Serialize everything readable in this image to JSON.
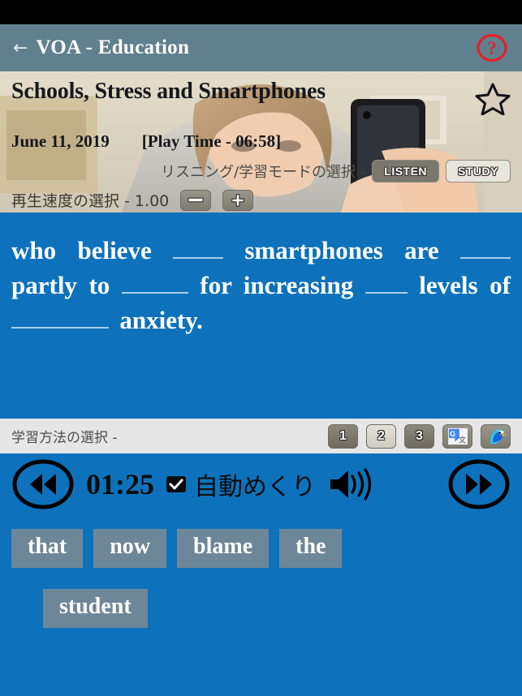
{
  "statusbar": {
    "name": "android-status-bar"
  },
  "appbar": {
    "back_label": "←",
    "title": "VOA - Education",
    "help_label": "?"
  },
  "article": {
    "title": "Schools, Stress and Smartphones",
    "date": "June 11, 2019",
    "play_time": "[Play Time - 06:58]",
    "favorite": "☆"
  },
  "mode_select": {
    "label": "リスニング/学習モードの選択 -",
    "listen_label": "LISTEN",
    "study_label": "STUDY",
    "listen_selected": true,
    "study_selected": false
  },
  "speed_select": {
    "label": "再生速度の選択 - 1.00",
    "value": "1.00",
    "minus_label": "−",
    "plus_label": "+"
  },
  "sentence": {
    "tokens": [
      {
        "type": "word",
        "text": "who"
      },
      {
        "type": "word",
        "text": "believe"
      },
      {
        "type": "blank",
        "size": "w1"
      },
      {
        "type": "word",
        "text": "smartphones"
      },
      {
        "type": "word",
        "text": "are"
      },
      {
        "type": "blank",
        "size": "w1"
      },
      {
        "type": "word",
        "text": "partly"
      },
      {
        "type": "word",
        "text": "to"
      },
      {
        "type": "blank",
        "size": "w2"
      },
      {
        "type": "word",
        "text": "for"
      },
      {
        "type": "word",
        "text": "increasing"
      },
      {
        "type": "blank",
        "size": "w3"
      },
      {
        "type": "word",
        "text": "levels"
      },
      {
        "type": "word",
        "text": "of"
      },
      {
        "type": "blank",
        "size": "w4"
      },
      {
        "type": "word",
        "text": "anxiety."
      }
    ],
    "plain_text": "who believe ____ smartphones are ____ partly to ______ for increasing ___ levels of _______ anxiety."
  },
  "method_select": {
    "label": "学習方法の選択 -",
    "buttons": [
      {
        "label": "1",
        "selected": false,
        "name": "method-button-1"
      },
      {
        "label": "2",
        "selected": true,
        "name": "method-button-2"
      },
      {
        "label": "3",
        "selected": false,
        "name": "method-button-3"
      }
    ],
    "google_translate_label": "G",
    "papago_label": "P"
  },
  "player": {
    "rewind_label": "◀◀",
    "elapsed": "01:25",
    "autoflip_label": "自動めくり",
    "autoflip_checked": true,
    "speaker_label": "🔊",
    "forward_label": "▶▶"
  },
  "word_bank": {
    "row1": [
      "that",
      "now",
      "blame",
      "the"
    ],
    "row2": [
      "student"
    ]
  },
  "colors": {
    "status_bar": "#000000",
    "appbar": "#61808f",
    "sentence_bg": "#0d72bb",
    "method_bar": "#e6e6e6",
    "chip": "#6d8799",
    "help_red": "#e8202a",
    "blank_line": "#a9cfe9"
  }
}
